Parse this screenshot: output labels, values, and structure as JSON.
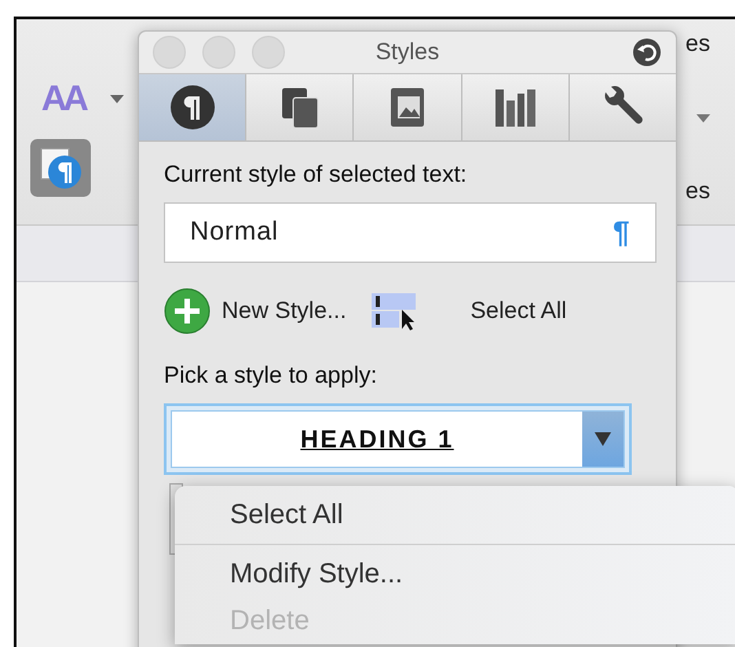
{
  "background": {
    "font_button": "AA",
    "fragments": [
      "es",
      "es"
    ]
  },
  "panel": {
    "title": "Styles",
    "tabs": [
      {
        "kind": "paragraph",
        "selected": true
      },
      {
        "kind": "pages",
        "selected": false
      },
      {
        "kind": "media",
        "selected": false
      },
      {
        "kind": "library",
        "selected": false
      },
      {
        "kind": "tools",
        "selected": false
      }
    ],
    "current_label": "Current style of selected text:",
    "current_style": "Normal",
    "pilcrow": "¶",
    "new_style": "New Style...",
    "select_all": "Select All",
    "pick_label": "Pick a style to apply:",
    "picked_style": "HEADING 1",
    "menu": [
      {
        "label": "Select All",
        "disabled": false
      },
      {
        "label": "Modify Style...",
        "disabled": false
      },
      {
        "label": "Delete",
        "disabled": true
      }
    ]
  }
}
